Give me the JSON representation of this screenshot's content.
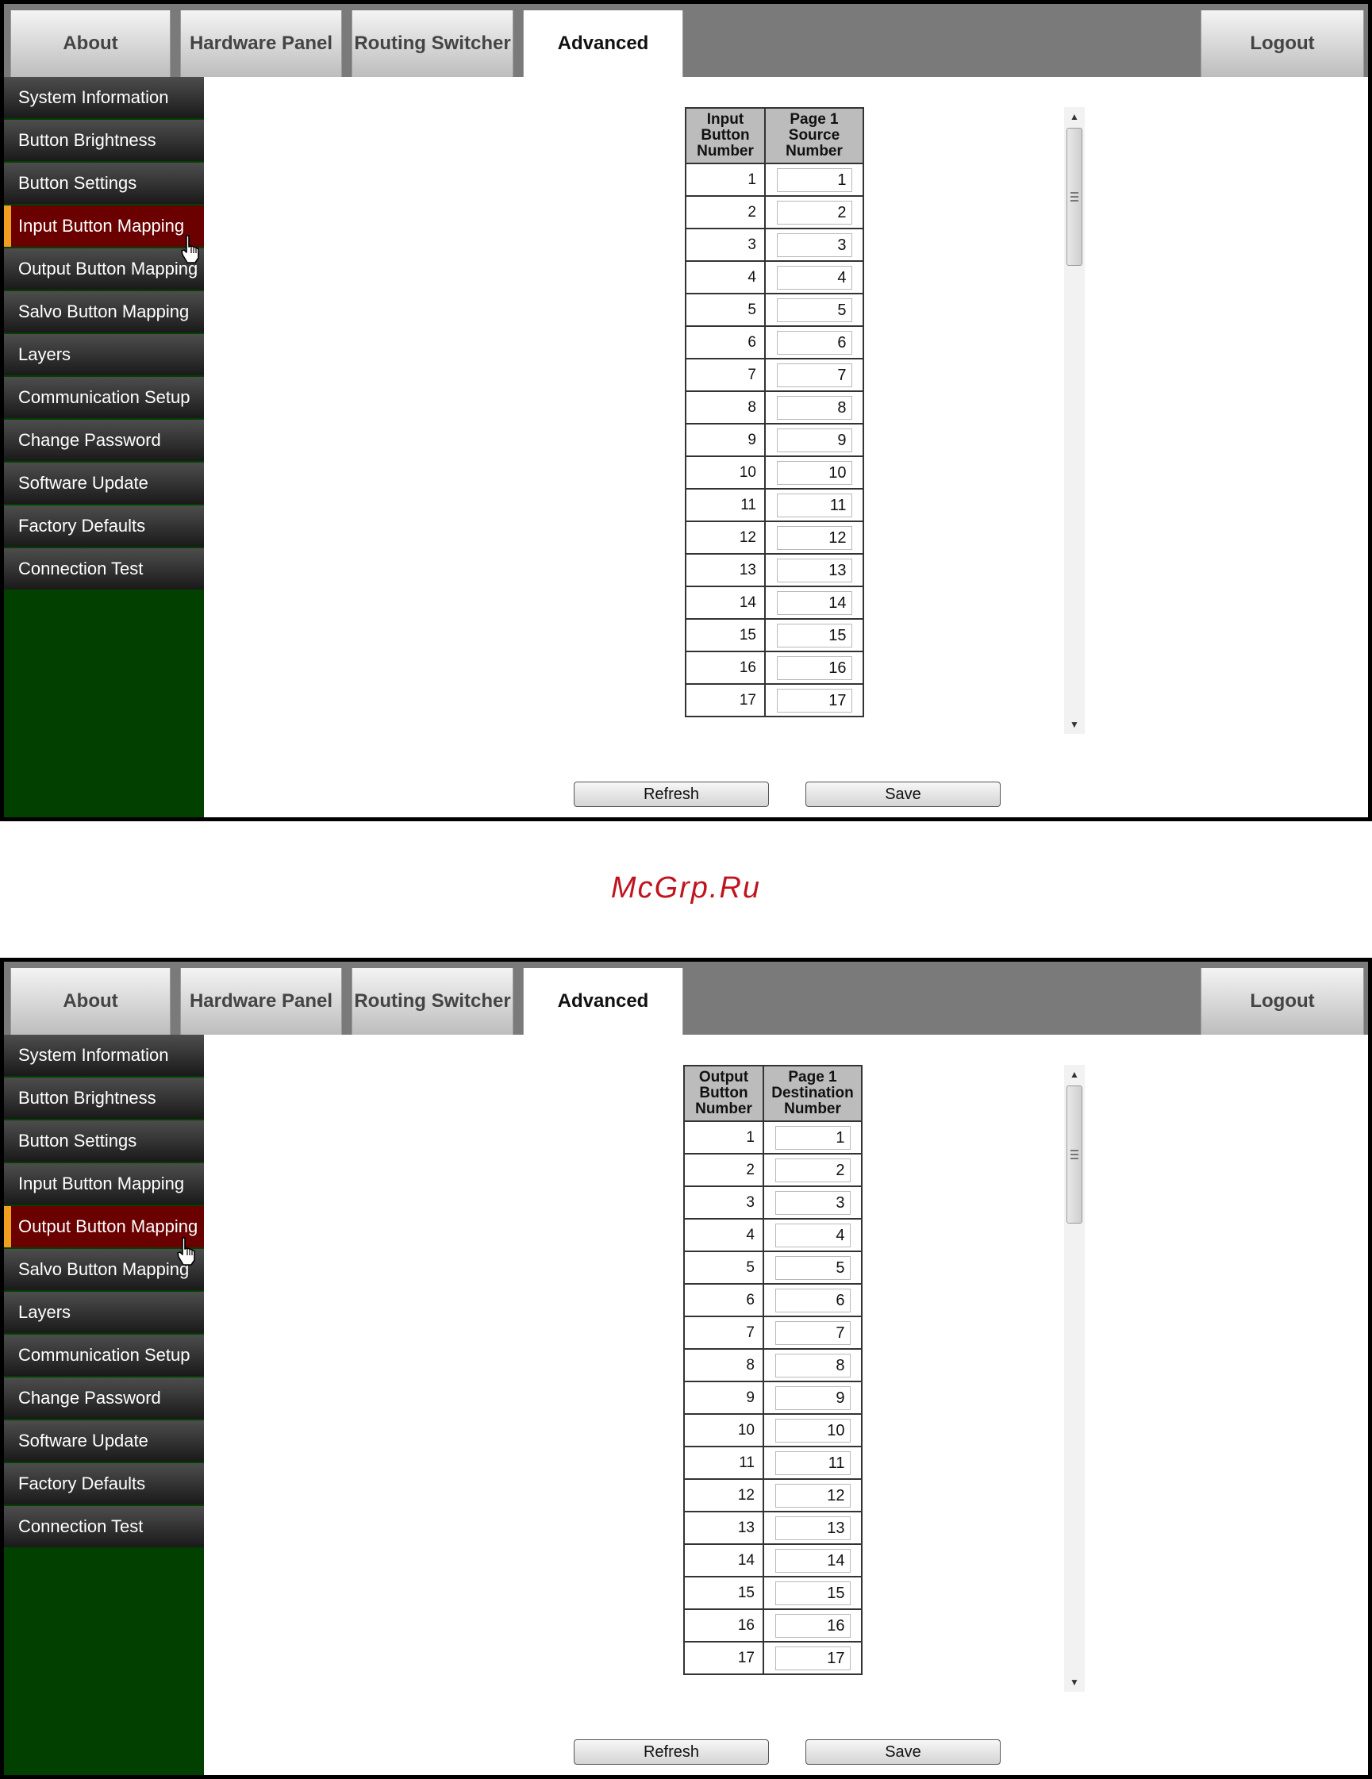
{
  "nav": {
    "tabs": [
      "About",
      "Hardware Panel",
      "Routing Switcher",
      "Advanced"
    ],
    "logout": "Logout"
  },
  "sidebar": {
    "items": [
      "System Information",
      "Button Brightness",
      "Button Settings",
      "Input Button Mapping",
      "Output Button Mapping",
      "Salvo Button Mapping",
      "Layers",
      "Communication Setup",
      "Change Password",
      "Software Update",
      "Factory Defaults",
      "Connection Test"
    ]
  },
  "screen1": {
    "active_menu": "Input Button Mapping",
    "col1_header": "Input Button Number",
    "col2_header": "Page 1 Source Number",
    "rows": [
      {
        "num": "1",
        "val": "1"
      },
      {
        "num": "2",
        "val": "2"
      },
      {
        "num": "3",
        "val": "3"
      },
      {
        "num": "4",
        "val": "4"
      },
      {
        "num": "5",
        "val": "5"
      },
      {
        "num": "6",
        "val": "6"
      },
      {
        "num": "7",
        "val": "7"
      },
      {
        "num": "8",
        "val": "8"
      },
      {
        "num": "9",
        "val": "9"
      },
      {
        "num": "10",
        "val": "10"
      },
      {
        "num": "11",
        "val": "11"
      },
      {
        "num": "12",
        "val": "12"
      },
      {
        "num": "13",
        "val": "13"
      },
      {
        "num": "14",
        "val": "14"
      },
      {
        "num": "15",
        "val": "15"
      },
      {
        "num": "16",
        "val": "16"
      },
      {
        "num": "17",
        "val": "17"
      }
    ]
  },
  "screen2": {
    "active_menu": "Output Button Mapping",
    "col1_header": "Output Button Number",
    "col2_header": "Page 1 Destination Number",
    "rows": [
      {
        "num": "1",
        "val": "1"
      },
      {
        "num": "2",
        "val": "2"
      },
      {
        "num": "3",
        "val": "3"
      },
      {
        "num": "4",
        "val": "4"
      },
      {
        "num": "5",
        "val": "5"
      },
      {
        "num": "6",
        "val": "6"
      },
      {
        "num": "7",
        "val": "7"
      },
      {
        "num": "8",
        "val": "8"
      },
      {
        "num": "9",
        "val": "9"
      },
      {
        "num": "10",
        "val": "10"
      },
      {
        "num": "11",
        "val": "11"
      },
      {
        "num": "12",
        "val": "12"
      },
      {
        "num": "13",
        "val": "13"
      },
      {
        "num": "14",
        "val": "14"
      },
      {
        "num": "15",
        "val": "15"
      },
      {
        "num": "16",
        "val": "16"
      },
      {
        "num": "17",
        "val": "17"
      }
    ]
  },
  "buttons": {
    "refresh": "Refresh",
    "save": "Save"
  },
  "watermark": "McGrp.Ru",
  "colors": {
    "active_menu_bg": "#6a0000",
    "active_menu_marker": "#f0a020",
    "sidebar_fill": "#024000"
  }
}
